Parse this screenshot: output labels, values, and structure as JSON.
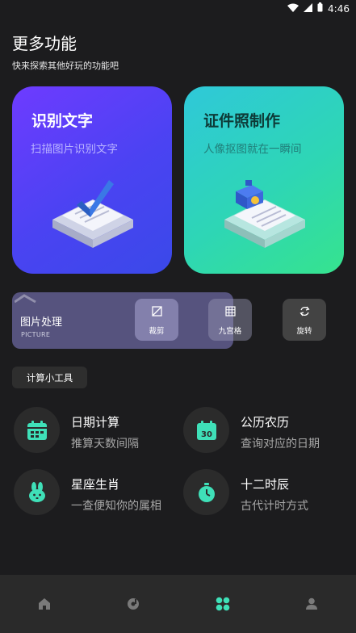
{
  "status_bar": {
    "time": "4:46"
  },
  "header": {
    "title": "更多功能",
    "subtitle": "快来探索其他好玩的功能吧"
  },
  "cards": [
    {
      "title": "识别文字",
      "subtitle": "扫描图片识别文字",
      "icon": "document-check-icon"
    },
    {
      "title": "证件照制作",
      "subtitle": "人像抠图就在一瞬间",
      "icon": "document-camera-icon"
    }
  ],
  "picture_tools": {
    "label": "图片处理",
    "label_en": "PICTURE",
    "buttons": [
      {
        "label": "裁剪",
        "icon": "crop-icon"
      },
      {
        "label": "九宫格",
        "icon": "grid-icon"
      },
      {
        "label": "旋转",
        "icon": "rotate-icon"
      }
    ]
  },
  "section": {
    "label": "计算小工具"
  },
  "utilities": [
    {
      "name": "日期计算",
      "desc": "推算天数间隔",
      "icon": "calendar-grid-icon"
    },
    {
      "name": "公历农历",
      "desc": "查询对应的日期",
      "icon": "calendar-30-icon"
    },
    {
      "name": "星座生肖",
      "desc": "一查便知你的属相",
      "icon": "rabbit-icon"
    },
    {
      "name": "十二时辰",
      "desc": "古代计时方式",
      "icon": "stopwatch-icon"
    }
  ],
  "tabs": [
    {
      "icon": "home-icon",
      "active": false
    },
    {
      "icon": "music-disc-icon",
      "active": false
    },
    {
      "icon": "apps-grid-icon",
      "active": true
    },
    {
      "icon": "profile-icon",
      "active": false
    }
  ],
  "colors": {
    "accent": "#3fe0b8",
    "background": "#1c1c1e",
    "card_left": "#5a40f5",
    "card_right": "#2fd6b0"
  }
}
